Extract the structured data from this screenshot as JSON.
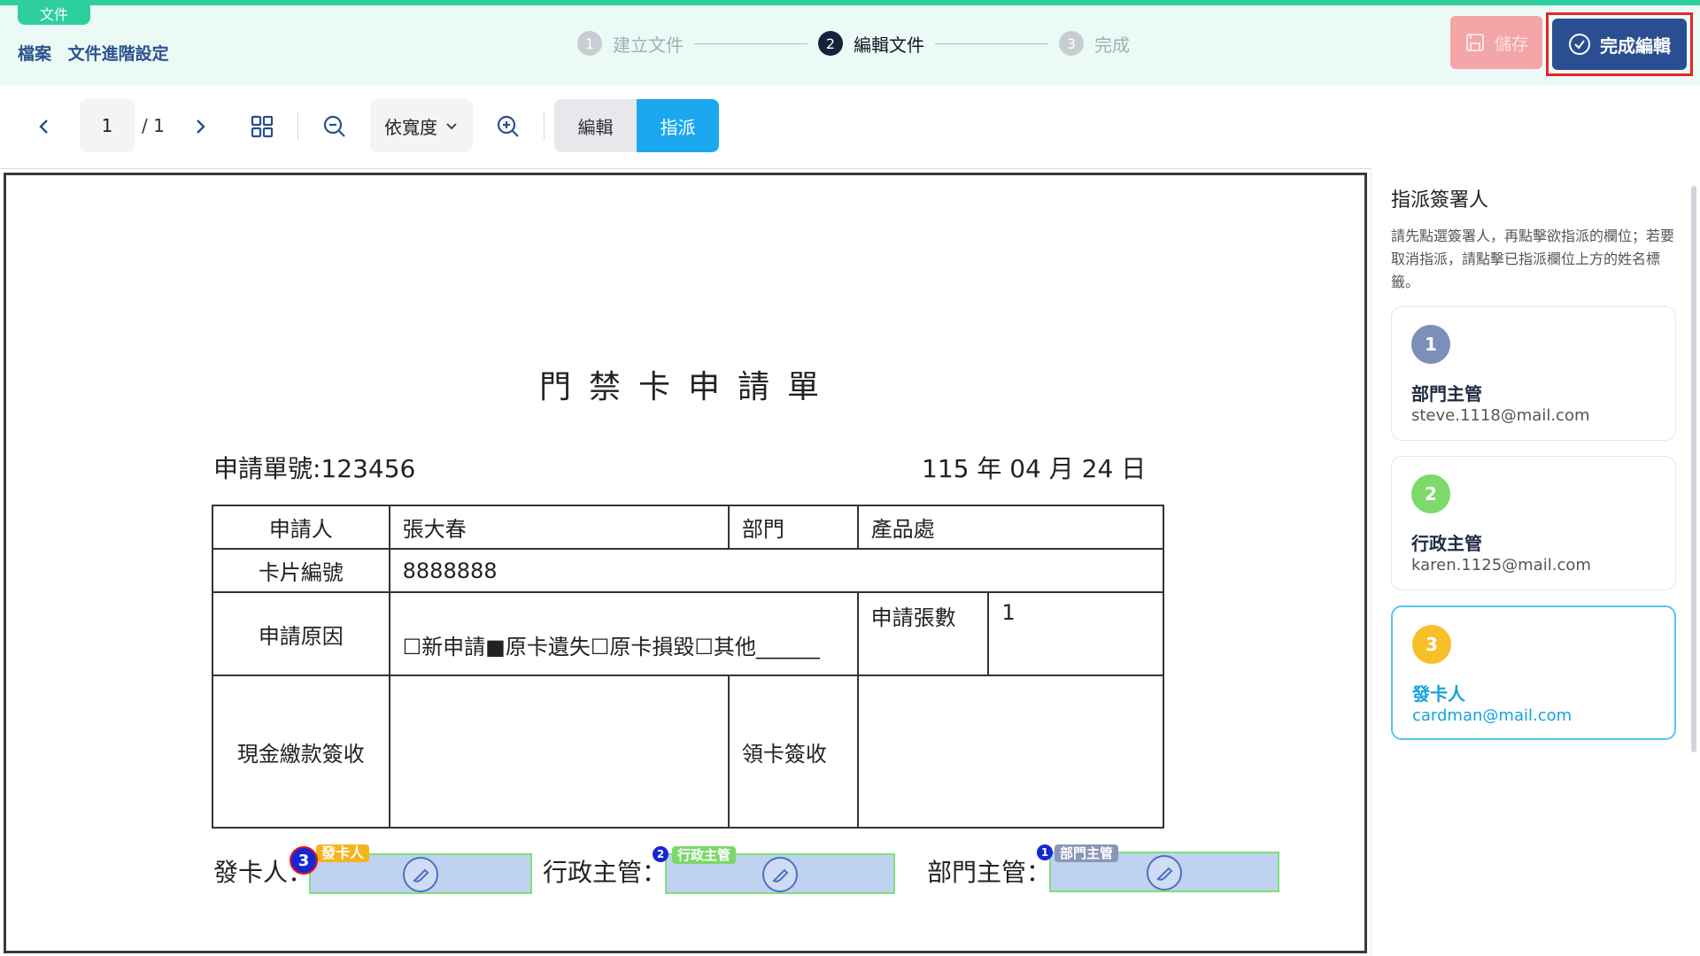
{
  "header": {
    "doc_tag": "文件",
    "breadcrumb": [
      "檔案",
      "文件進階設定"
    ],
    "steps": [
      {
        "num": "1",
        "label": "建立文件",
        "state": "done"
      },
      {
        "num": "2",
        "label": "編輯文件",
        "state": "active"
      },
      {
        "num": "3",
        "label": "完成",
        "state": "pending"
      }
    ],
    "save_label": "儲存",
    "finish_label": "完成編輯"
  },
  "toolbar": {
    "current_page": "1",
    "total_pages": "/ 1",
    "zoom": "依寬度",
    "mode_edit": "編輯",
    "mode_assign": "指派"
  },
  "document": {
    "title": "門禁卡申請單",
    "form_no": "申請單號:123456",
    "date": "115 年 04 月 24 日",
    "labels": {
      "applicant": "申請人",
      "department": "部門",
      "card_no": "卡片編號",
      "reason": "申請原因",
      "count": "申請張數",
      "cash_sign": "現金繳款簽收",
      "receive_sign": "領卡簽收"
    },
    "values": {
      "applicant": "張大春",
      "department": "產品處",
      "card_no": "8888888",
      "reason": "☐新申請■原卡遺失☐原卡損毀☐其他______",
      "count": "1"
    },
    "signatures": [
      {
        "label": "發卡人：",
        "tag": "發卡人",
        "num": "3",
        "tag_color": "#f5b31c"
      },
      {
        "label": "行政主管：",
        "tag": "行政主管",
        "num": "2",
        "tag_color": "#7bd86a"
      },
      {
        "label": "部門主管：",
        "tag": "部門主管",
        "num": "1",
        "tag_color": "#8a96b5"
      }
    ]
  },
  "panel": {
    "title": "指派簽署人",
    "description": "請先點選簽署人，再點擊欲指派的欄位；若要取消指派，請點擊已指派欄位上方的姓名標籤。",
    "signers": [
      {
        "num": "1",
        "role": "部門主管",
        "email": "steve.1118@mail.com",
        "color": "#7b8fb8"
      },
      {
        "num": "2",
        "role": "行政主管",
        "email": "karen.1125@mail.com",
        "color": "#7dd96a"
      },
      {
        "num": "3",
        "role": "發卡人",
        "email": "cardman@mail.com",
        "color": "#f7c02a"
      }
    ]
  },
  "colors": {
    "accent": "#2ecf9f",
    "primary": "#2a4e91",
    "assign": "#1ba8f0",
    "highlight": "#e5242b"
  }
}
